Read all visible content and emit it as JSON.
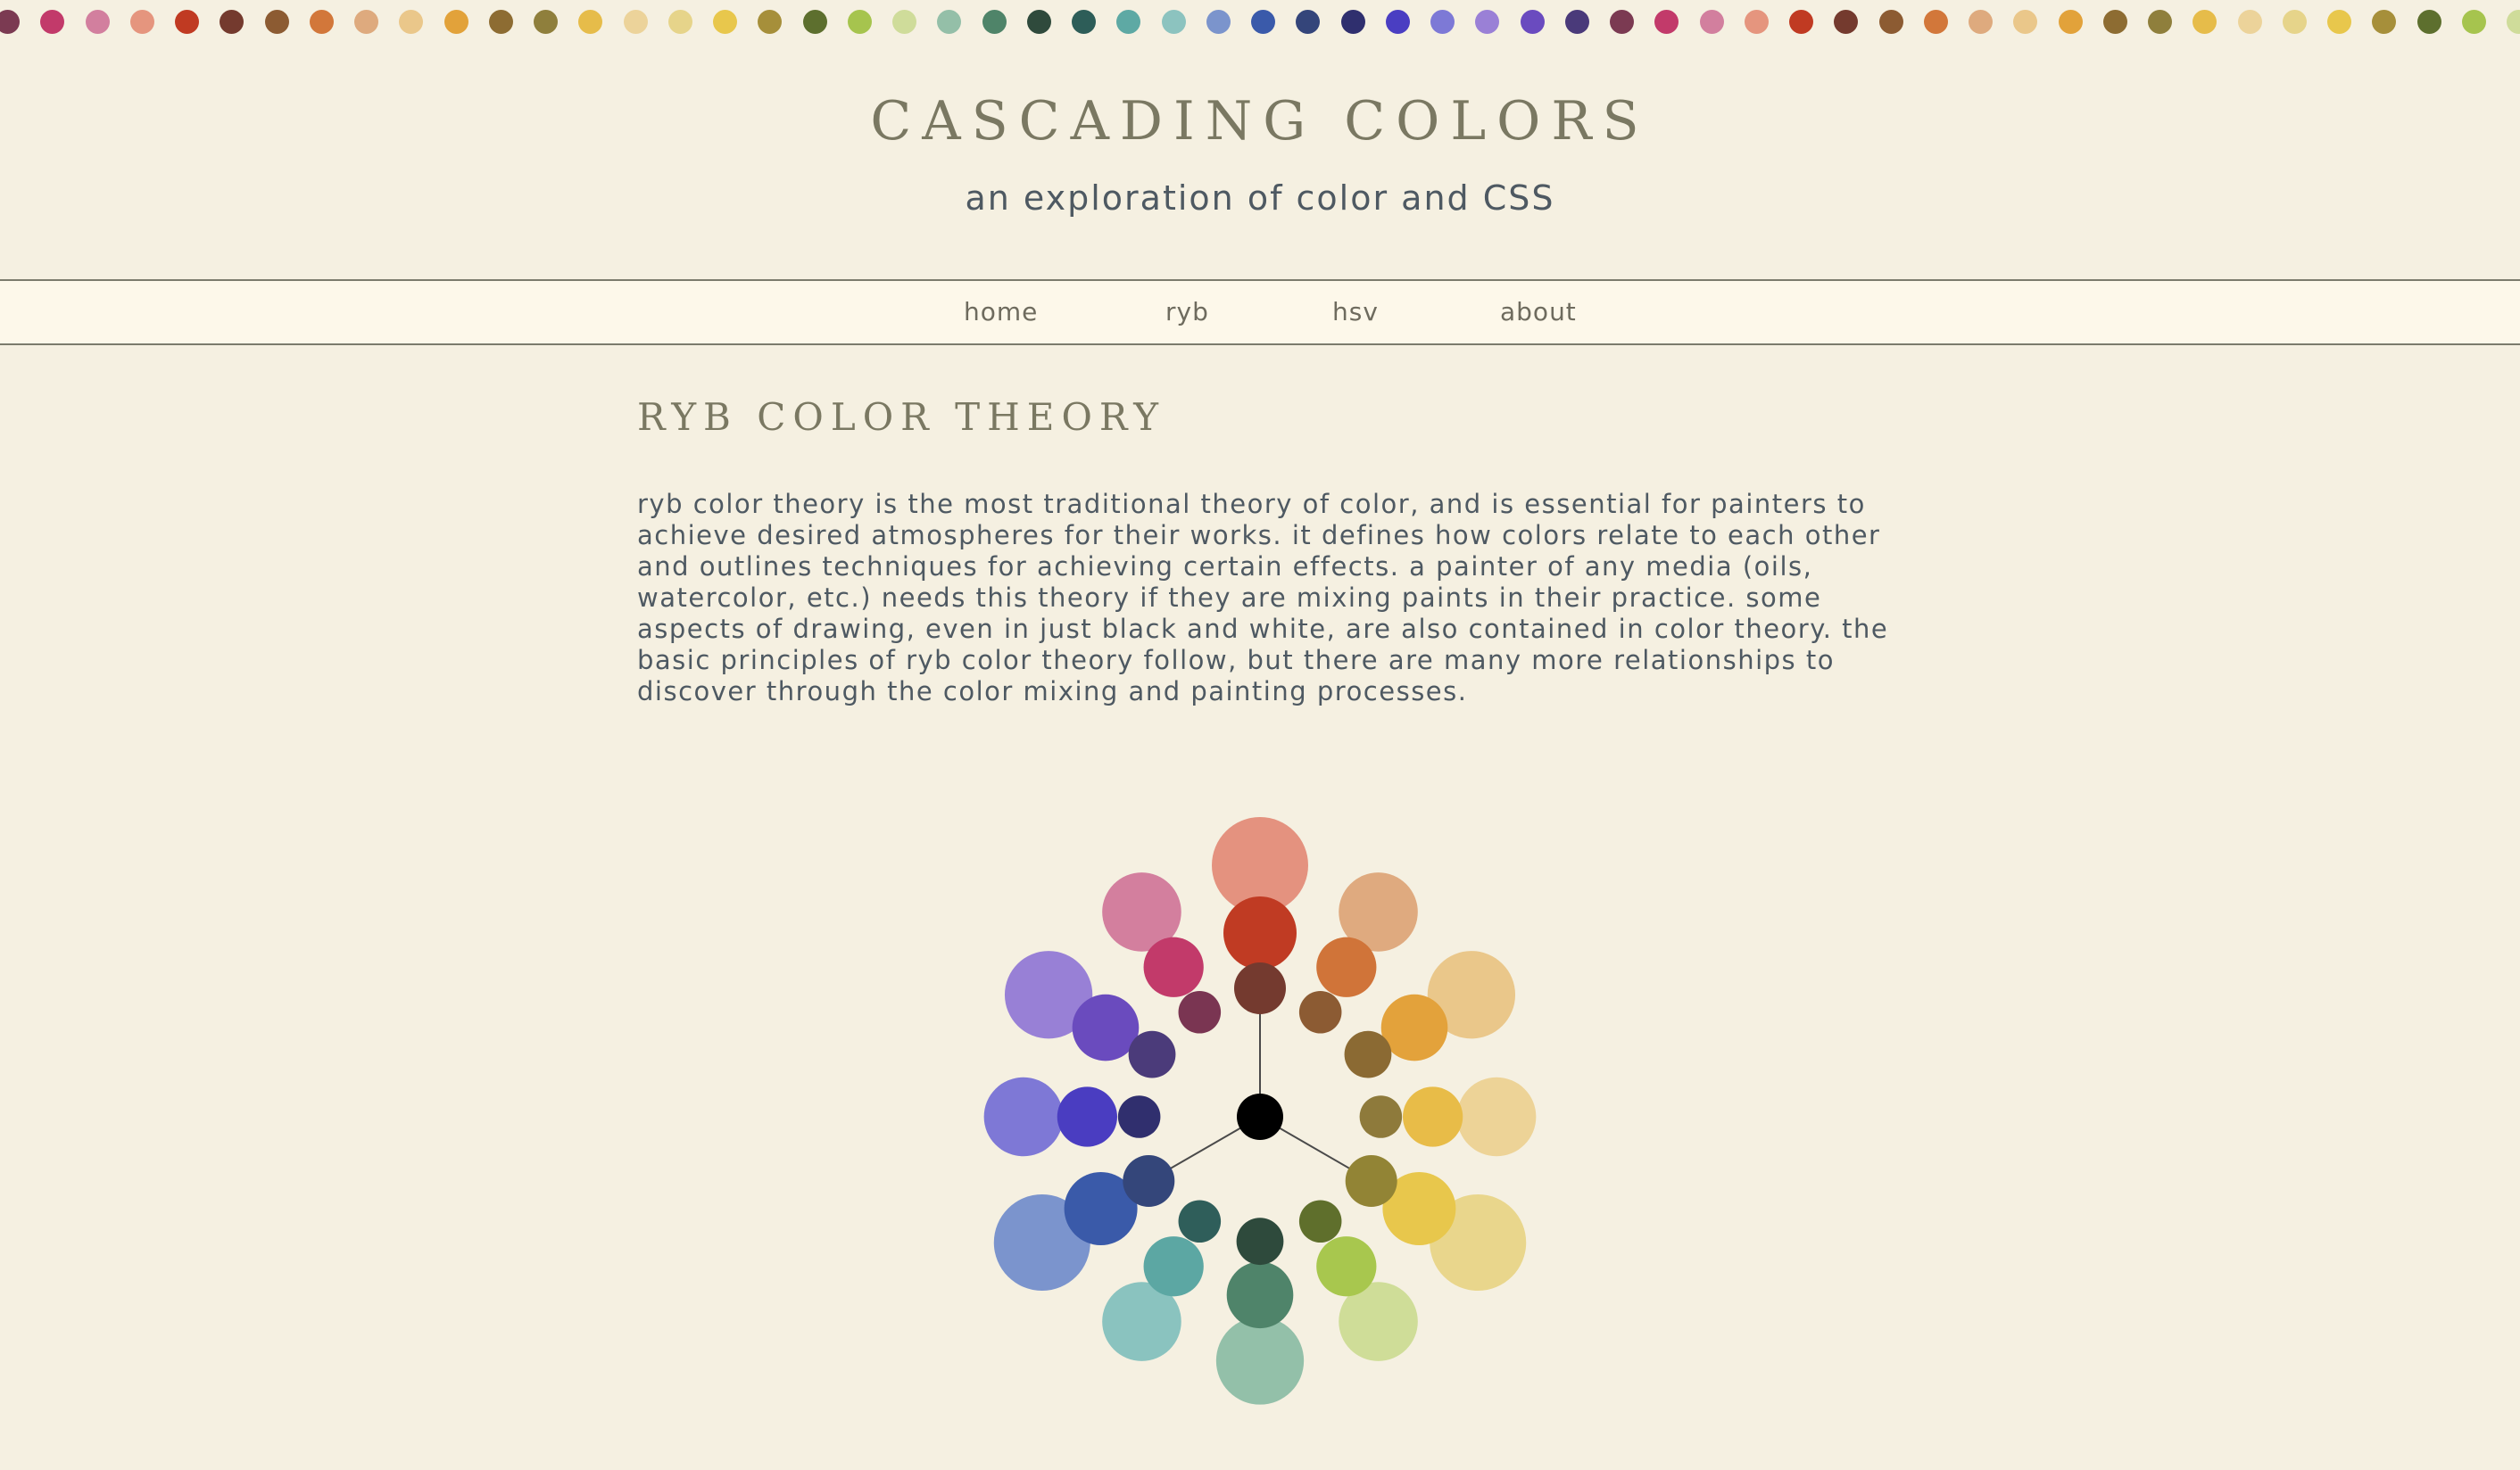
{
  "header": {
    "title": "CASCADING COLORS",
    "subtitle": "an exploration of color and CSS"
  },
  "nav": {
    "items": [
      "home",
      "ryb",
      "hsv",
      "about"
    ]
  },
  "main": {
    "heading": "RYB COLOR THEORY",
    "body": "ryb color theory is the most traditional theory of color, and is essential for painters to achieve desired atmospheres for their works. it defines how colors relate to each other and outlines techniques for achieving certain effects. a painter of any media (oils, watercolor, etc.) needs this theory if they are mixing paints in their practice. some aspects of drawing, even in just black and white, are also contained in color theory. the basic principles of ryb color theory follow, but there are many more relationships to discover through the color mixing and painting processes."
  },
  "palette_strip": [
    "#7b3a52",
    "#c23a6a",
    "#d27f9e",
    "#e5957e",
    "#c03a22",
    "#743a2e",
    "#8c5b32",
    "#d2773a",
    "#deaa7e",
    "#eac78a",
    "#e2a23a",
    "#8d6c32",
    "#8f7f3c",
    "#e6bc4a",
    "#ecd39a",
    "#e6d48a",
    "#e8c74c",
    "#a68f3a",
    "#5d6f2e",
    "#a6c44e",
    "#cfdc9a",
    "#94bfa8",
    "#4f8469",
    "#2f4a3c",
    "#2d5d58",
    "#5ea9a4",
    "#8cc3bf",
    "#7b94cc",
    "#3a5aaa",
    "#34457a",
    "#2f2f6e",
    "#4a3ec2",
    "#7d79d6",
    "#9a80d6",
    "#6a4bbf",
    "#4a3a7a",
    "#7b3a52",
    "#c23a6a",
    "#d27f9e",
    "#e5957e",
    "#c03a22",
    "#743a2e",
    "#8c5b32",
    "#d2773a",
    "#deaa7e",
    "#eac78a",
    "#e2a23a",
    "#8d6c32",
    "#8f7f3c",
    "#e6bc4a",
    "#ecd39a",
    "#e6d48a",
    "#e8c74c",
    "#a68f3a",
    "#5d6f2e",
    "#a6c44e",
    "#cfdc9a"
  ],
  "wheel_colors": {
    "center": "#000000",
    "line": "#4a4a4a",
    "spokes": [
      {
        "tint": "#e4927f",
        "base": "#c03b23",
        "shade": "#743a2f"
      },
      {
        "tint": "#dfaa7f",
        "base": "#d07439",
        "shade": "#8c5b33"
      },
      {
        "tint": "#eac78a",
        "base": "#e3a23b",
        "shade": "#8b6a33"
      },
      {
        "tint": "#edd397",
        "base": "#e8bc48",
        "shade": "#8e7a3b"
      },
      {
        "tint": "#e9d68c",
        "base": "#e8c74c",
        "shade": "#928435"
      },
      {
        "tint": "#cfdd98",
        "base": "#a8c74e",
        "shade": "#5f6f2c"
      },
      {
        "tint": "#93c0a9",
        "base": "#4f846a",
        "shade": "#2e4a3c"
      },
      {
        "tint": "#8ac3bf",
        "base": "#5ca7a3",
        "shade": "#2f5e5a"
      },
      {
        "tint": "#7b94cd",
        "base": "#3a5aa9",
        "shade": "#34467a"
      },
      {
        "tint": "#7e78d6",
        "base": "#4a3dc1",
        "shade": "#302f6e"
      },
      {
        "tint": "#9880d6",
        "base": "#6a4bbe",
        "shade": "#4b3b7a"
      },
      {
        "tint": "#d37f9e",
        "base": "#c23a6a",
        "shade": "#7a3552"
      }
    ]
  }
}
